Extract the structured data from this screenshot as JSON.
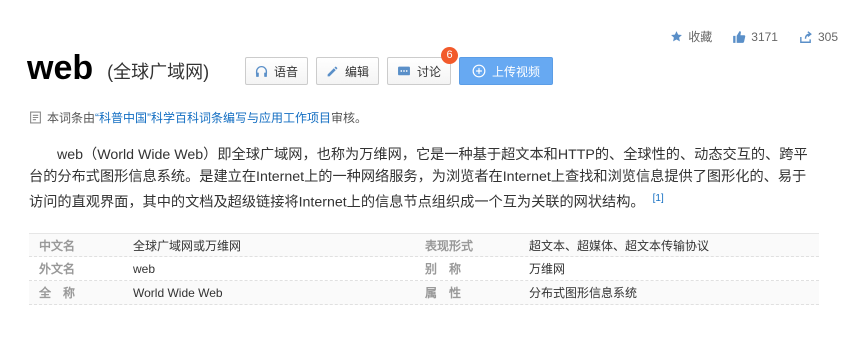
{
  "top_actions": {
    "favorite_label": "收藏",
    "like_count": "3171",
    "share_count": "305"
  },
  "entry": {
    "title": "web",
    "subtitle": "(全球广域网)"
  },
  "buttons": {
    "voice": "语音",
    "edit": "编辑",
    "discuss": "讨论",
    "discuss_badge": "6",
    "upload_video": "上传视频"
  },
  "review": {
    "prefix": "本词条由",
    "link1": "“科普中国”",
    "link2": "科学百科词条编写与应用工作项目",
    "suffix": " 审核。"
  },
  "summary": {
    "text": "web（World Wide Web）即全球广域网，也称为万维网，它是一种基于超文本和HTTP的、全球性的、动态交互的、跨平台的分布式图形信息系统。是建立在Internet上的一种网络服务，为浏览者在Internet上查找和浏览信息提供了图形化的、易于访问的直观界面，其中的文档及超级链接将Internet上的信息节点组织成一个互为关联的网状结构。",
    "ref": "[1]"
  },
  "info_rows": [
    {
      "k1": "中文名",
      "v1": "全球广域网或万维网",
      "k2": "表现形式",
      "v2": "超文本、超媒体、超文本传输协议"
    },
    {
      "k1": "外文名",
      "v1": "web",
      "k2": "别　称",
      "v2": "万维网"
    },
    {
      "k1": "全　称",
      "v1": "World Wide Web",
      "k2": "属　性",
      "v2": "分布式图形信息系统"
    }
  ],
  "colors": {
    "link": "#136ec2",
    "primary_button": "#67a9f2",
    "badge": "#f25a2b",
    "icon": "#5a8fc8"
  }
}
